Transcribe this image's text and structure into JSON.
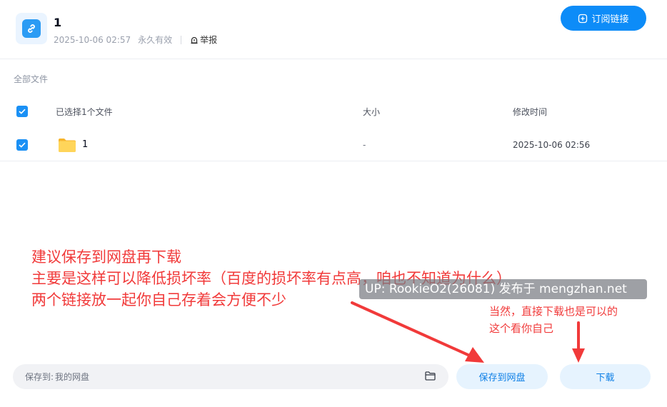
{
  "header": {
    "title": "1",
    "created": "2025-10-06 02:57",
    "validity": "永久有效",
    "report_label": "举报",
    "subscribe_label": "订阅链接"
  },
  "breadcrumb": "全部文件",
  "table": {
    "columns": [
      "已选择1个文件",
      "大小",
      "修改时间"
    ],
    "rows": [
      {
        "name": "1",
        "size": "-",
        "modified": "2025-10-06 02:56",
        "checked": true
      }
    ]
  },
  "annotations": {
    "main_lines": [
      "建议保存到网盘再下载",
      "主要是这样可以降低损坏率（百度的损坏率有点高，咱也不知道为什么）",
      "两个链接放一起你自己存着会方便不少"
    ],
    "side_lines": [
      "当然，直接下载也是可以的",
      "这个看你自己"
    ],
    "watermark": "UP: RookieO2(26081) 发布于 mengzhan.net"
  },
  "footer": {
    "save_to_label": "保存到:",
    "save_to_value": "我的网盘",
    "save_button": "保存到网盘",
    "download_button": "下载"
  },
  "colors": {
    "accent": "#0d8cf8",
    "annotation": "#f13a3a",
    "folder": "#ffc53d"
  },
  "icons": [
    "link-icon",
    "report-icon",
    "subscribe-plus-icon",
    "checkbox-icon",
    "folder-icon",
    "folder-picker-icon"
  ]
}
